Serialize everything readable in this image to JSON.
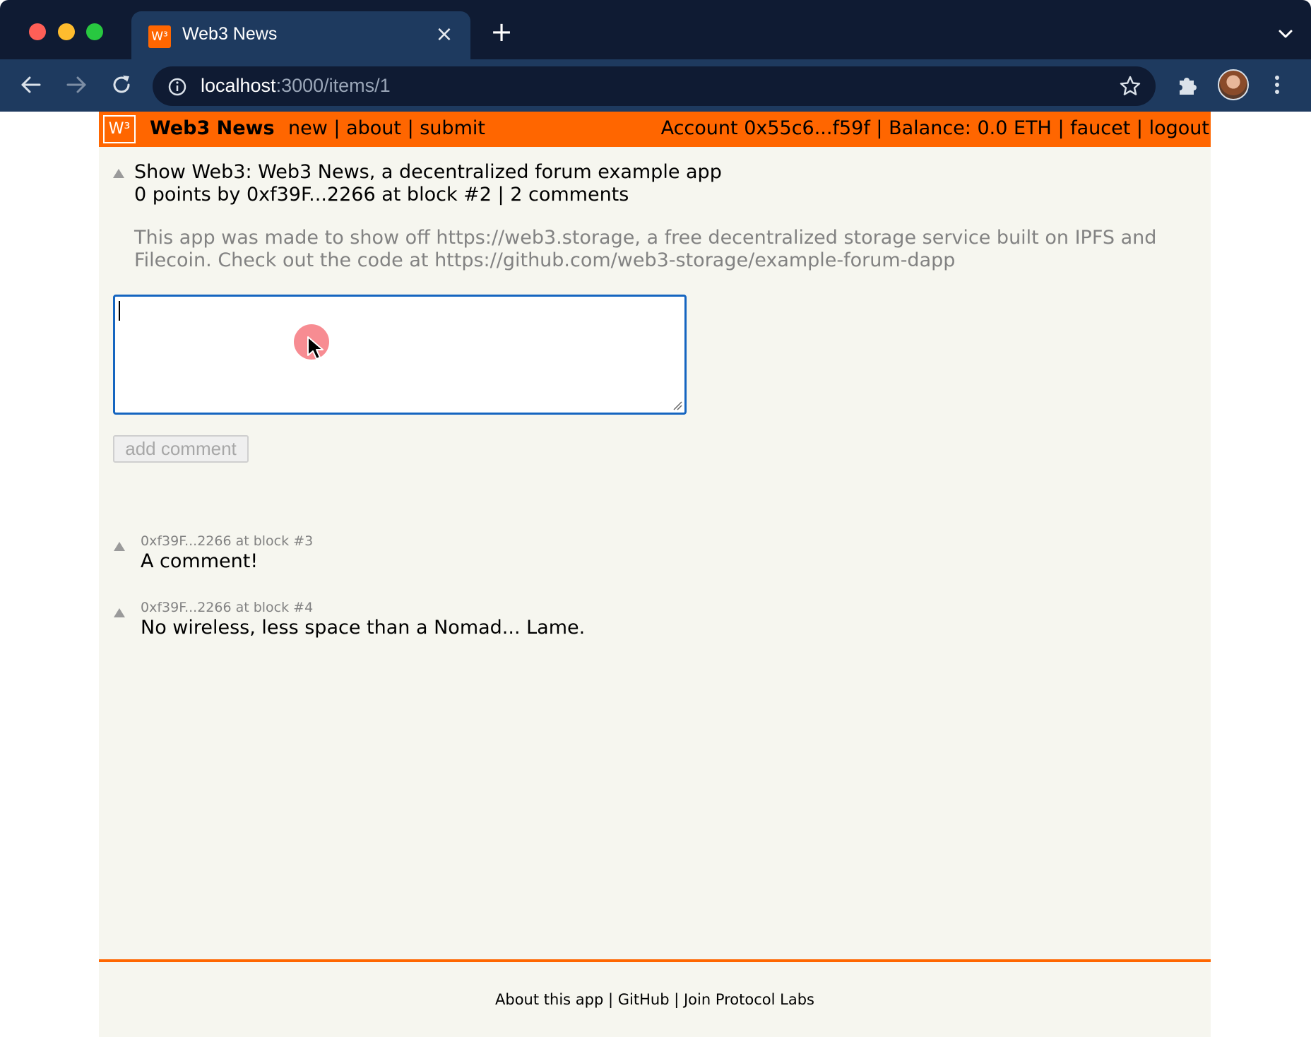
{
  "browser": {
    "tab_title": "Web3 News",
    "tab_favicon_text": "W³",
    "url_host": "localhost",
    "url_rest": ":3000/items/1",
    "icons": {
      "back": "arrow-left-icon",
      "forward": "arrow-right-icon",
      "reload": "reload-icon",
      "info": "info-icon",
      "bookmark": "star-icon",
      "extensions": "puzzle-icon",
      "menu": "kebab-icon",
      "tab_close": "close-icon",
      "new_tab": "plus-icon",
      "tab_list": "chevron-down-icon"
    }
  },
  "header": {
    "logo_text": "W³",
    "brand": "Web3 News",
    "nav": [
      "new",
      "about",
      "submit"
    ],
    "separator": " | ",
    "account": "Account 0x55c6...f59f",
    "balance": "Balance: 0.0 ETH",
    "faucet": "faucet",
    "logout": "logout"
  },
  "story": {
    "title": "Show Web3: Web3 News, a decentralized forum example app",
    "points": "0 points by 0xf39F...2266 at block #2",
    "comments_link": "2 comments",
    "text": "This app was made to show off https://web3.storage, a free decentralized storage service built on IPFS and Filecoin. Check out the code at https://github.com/web3-storage/example-forum-dapp"
  },
  "comment_form": {
    "value": "",
    "button_label": "add comment"
  },
  "comments": [
    {
      "meta": "0xf39F...2266 at block #3",
      "text": "A comment!"
    },
    {
      "meta": "0xf39F...2266 at block #4",
      "text": "No wireless, less space than a Nomad... Lame."
    }
  ],
  "footer": {
    "links": [
      "About this app",
      "GitHub",
      "Join Protocol Labs"
    ]
  },
  "colors": {
    "accent": "#ff6600",
    "page_bg": "#f6f6ef",
    "chrome_dark": "#0f1b33",
    "chrome_tab": "#1e3a5f",
    "focus": "#1565c0",
    "muted_text": "#828282"
  }
}
